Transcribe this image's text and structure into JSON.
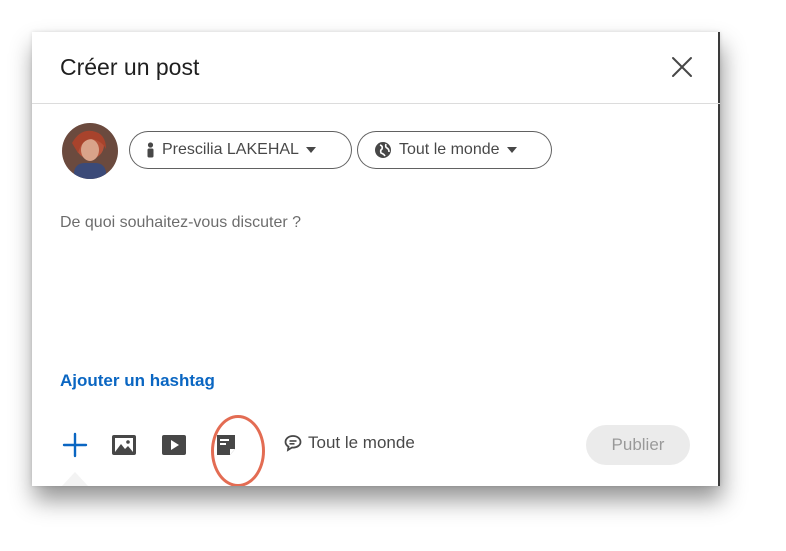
{
  "dialog": {
    "title": "Créer un post",
    "close_icon": "close-icon"
  },
  "author": {
    "name": "Prescilia LAKEHAL",
    "icon": "person-icon"
  },
  "audience": {
    "label": "Tout le monde",
    "icon": "globe-icon"
  },
  "editor": {
    "placeholder": "De quoi souhaitez-vous discuter ?"
  },
  "hashtag": {
    "label": "Ajouter un hashtag"
  },
  "toolbar": {
    "icons": [
      "plus-icon",
      "photo-icon",
      "video-icon",
      "document-icon"
    ],
    "comment_setting": "Tout le monde",
    "publish_label": "Publier"
  },
  "colors": {
    "link": "#0a66c2",
    "highlight": "#e36c53",
    "publish_disabled_bg": "#ebebeb"
  }
}
